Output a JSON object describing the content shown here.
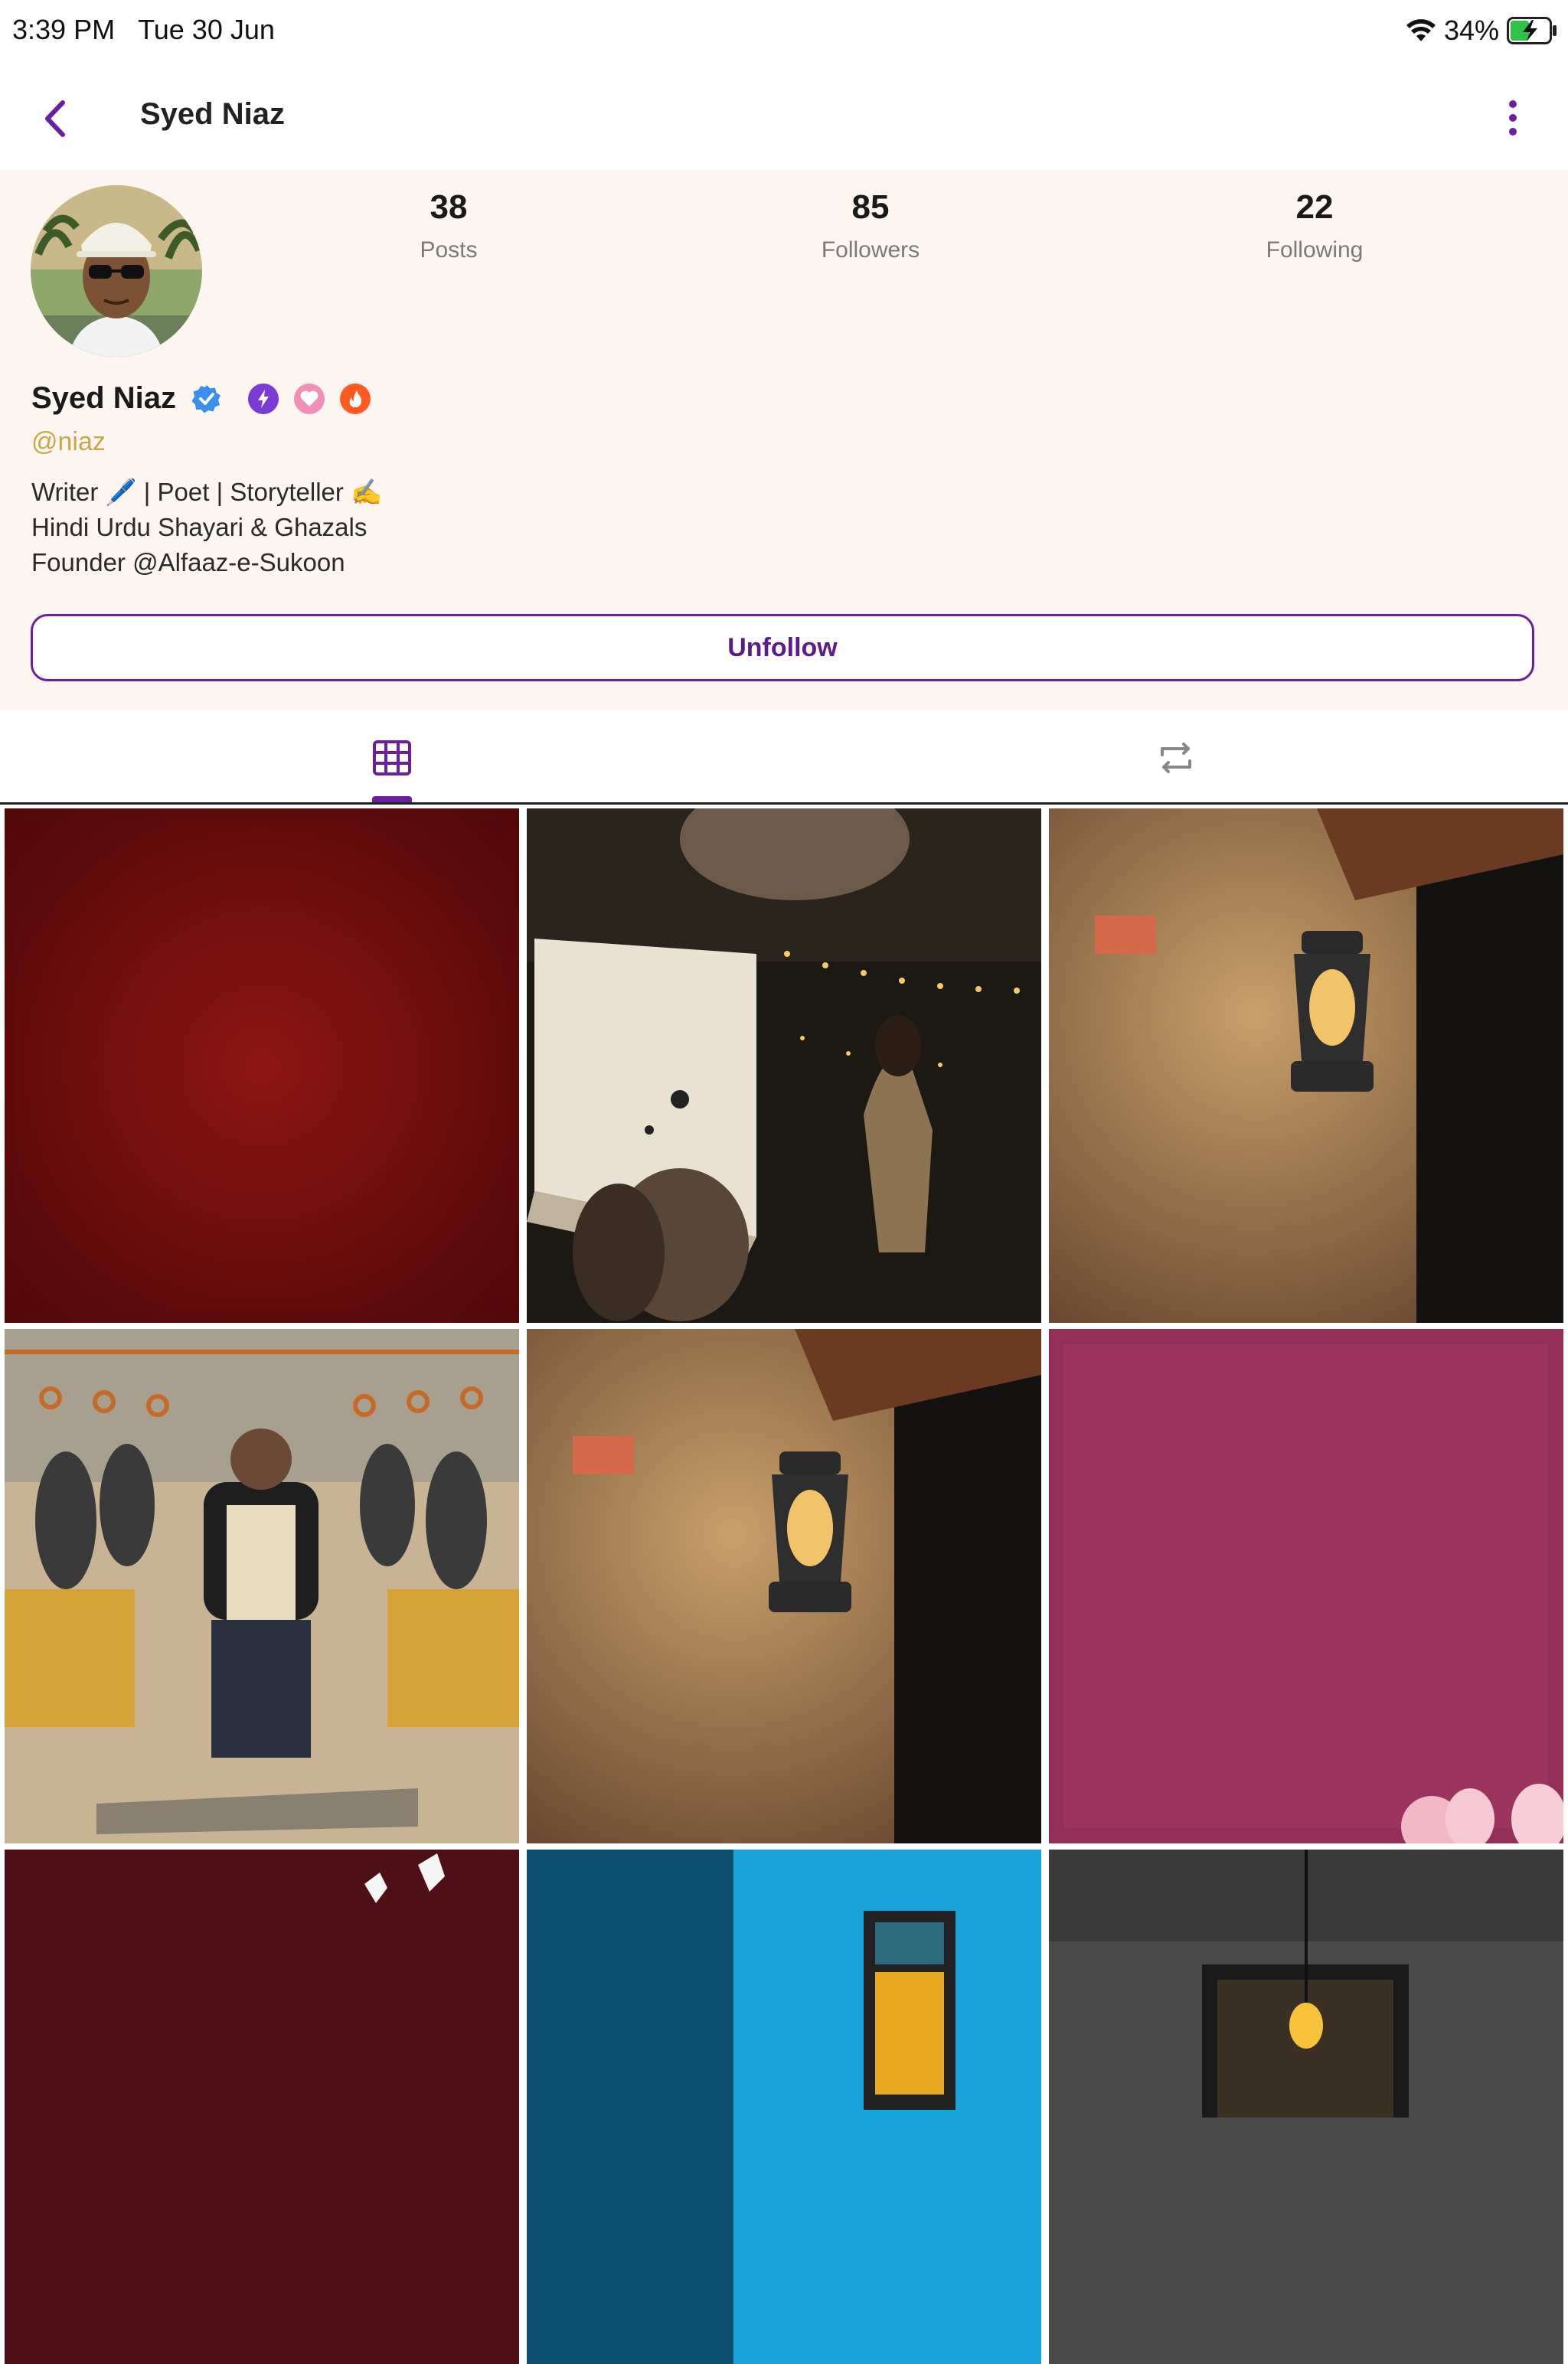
{
  "status_bar": {
    "time": "3:39 PM",
    "date": "Tue 30 Jun",
    "battery": "34%",
    "wifi_icon": "wifi-icon",
    "battery_icon": "battery-charging-icon"
  },
  "nav": {
    "title": "Syed Niaz",
    "back_icon": "chevron-left-icon",
    "more_icon": "more-vertical-icon"
  },
  "profile": {
    "stats": [
      {
        "value": "38",
        "label": "Posts"
      },
      {
        "value": "85",
        "label": "Followers"
      },
      {
        "value": "22",
        "label": "Following"
      }
    ],
    "name": "Syed Niaz",
    "handle": "@niaz",
    "bio": [
      "Writer 🖊️ | Poet | Storyteller ✍️",
      "Hindi Urdu Shayari & Ghazals",
      "Founder @Alfaaz-e-Sukoon"
    ],
    "badges": [
      "verified-icon",
      "bolt-badge-icon",
      "heart-badge-icon",
      "flame-badge-icon"
    ],
    "unfollow_label": "Unfollow"
  },
  "tabs": [
    {
      "icon": "grid-icon",
      "active": true
    },
    {
      "icon": "repost-icon",
      "active": false
    }
  ],
  "colors": {
    "accent": "#6a1fa0",
    "header_bg": "#fdf6f0",
    "handle": "#c8a84a"
  },
  "posts": [
    {
      "theme": "dark red texture"
    },
    {
      "theme": "woman writing by lantern light"
    },
    {
      "theme": "oil lantern on stone wall"
    },
    {
      "theme": "crowded train carriage illustration"
    },
    {
      "theme": "oil lantern on stone wall"
    },
    {
      "theme": "magenta textured paper with tulips"
    },
    {
      "theme": "dark maroon with white doves"
    },
    {
      "theme": "blue wall with yellow window"
    },
    {
      "theme": "grey wall with hanging bulb"
    }
  ]
}
